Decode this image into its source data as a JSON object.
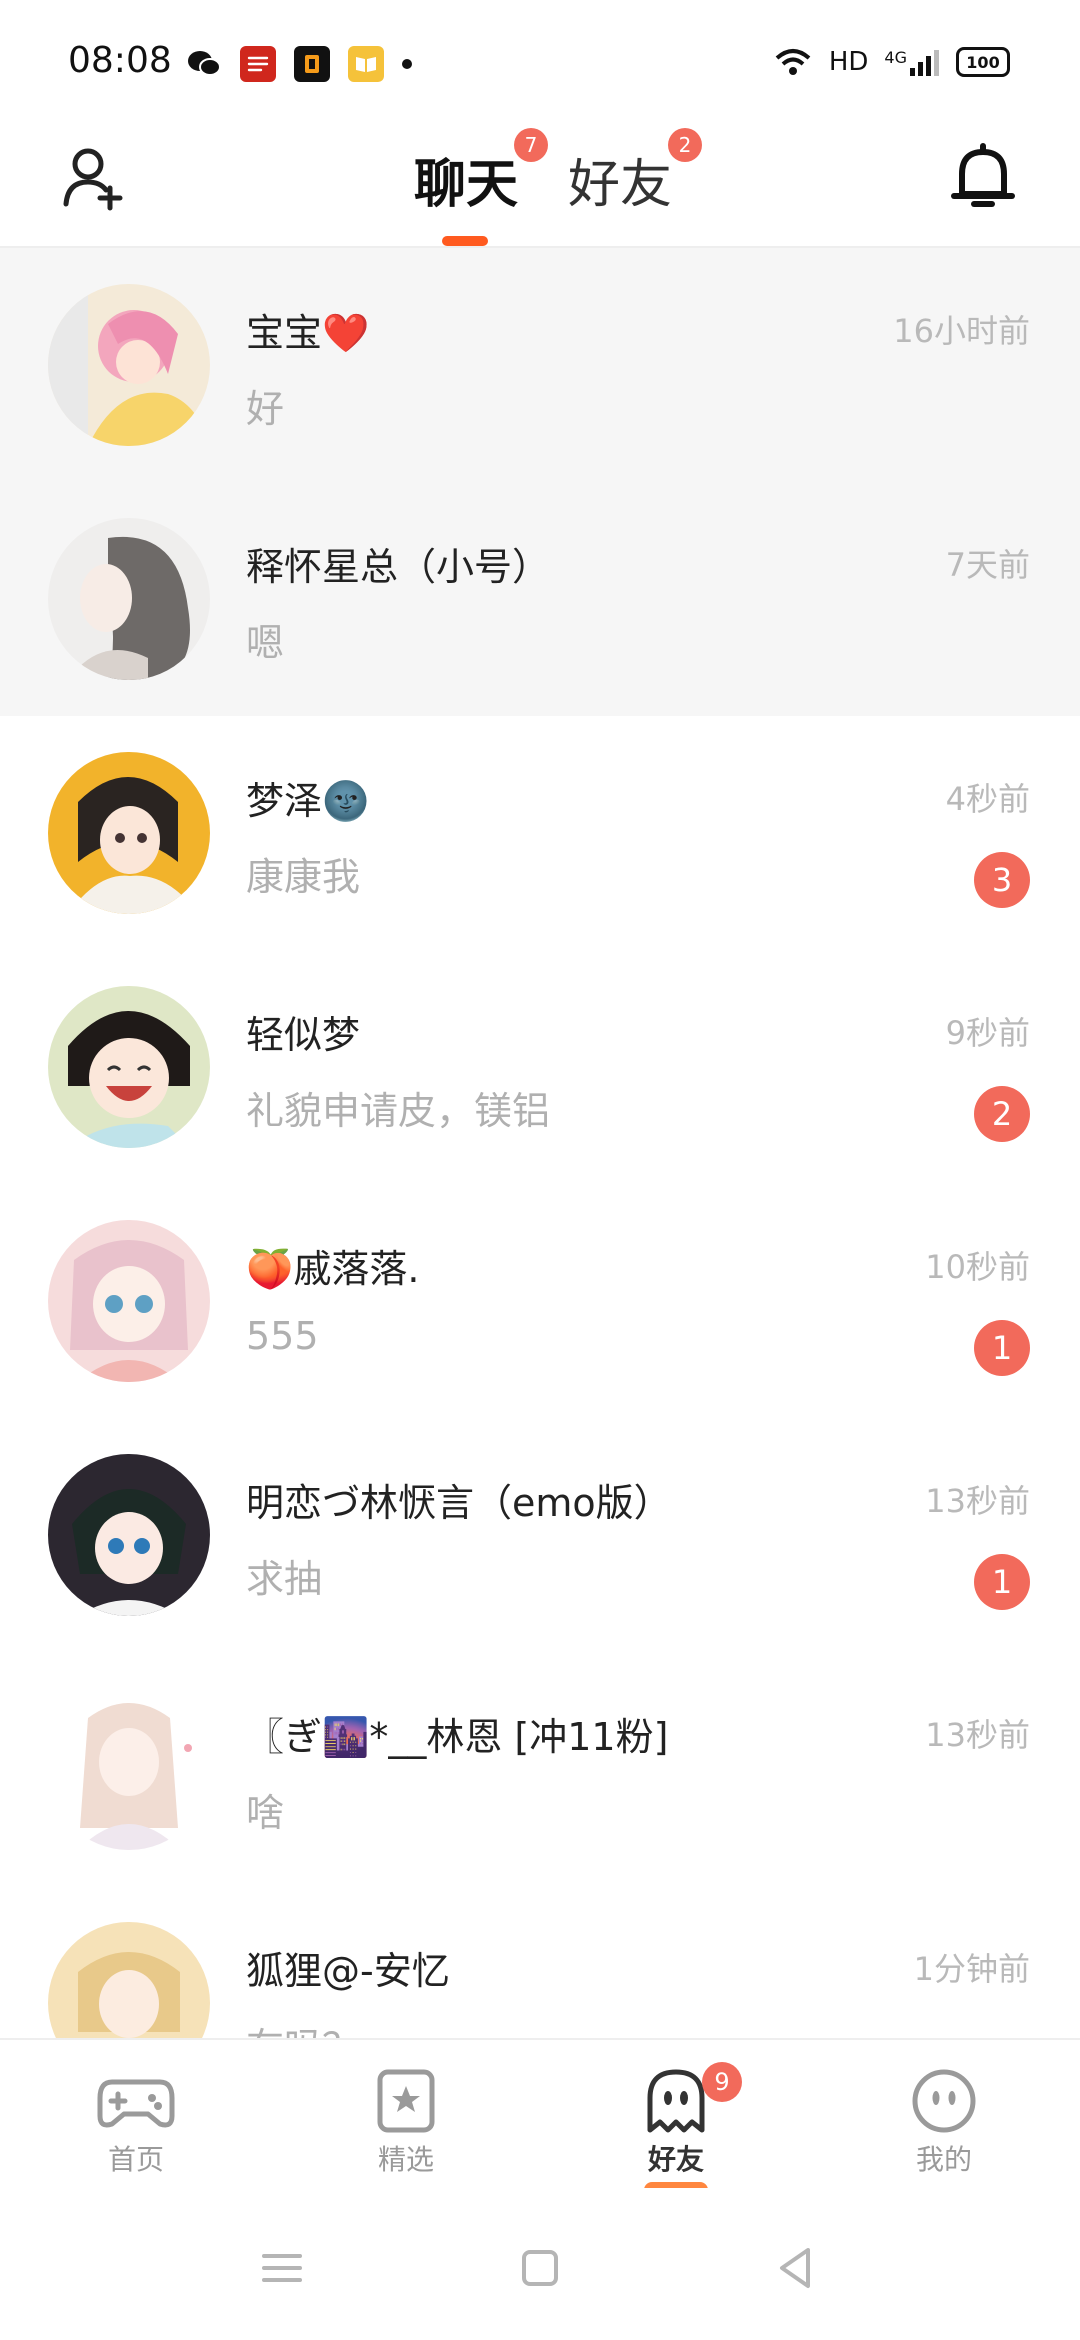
{
  "status_bar": {
    "time": "08:08",
    "network": "HD",
    "signal": "4G",
    "battery": "100"
  },
  "header": {
    "tabs": [
      {
        "label": "聊天",
        "badge": "7"
      },
      {
        "label": "好友",
        "badge": "2"
      }
    ]
  },
  "chats": [
    {
      "name": "宝宝❤️",
      "message": "好",
      "time": "16小时前",
      "pinned": true
    },
    {
      "name": "释怀星总（小号）",
      "message": "嗯",
      "time": "7天前",
      "pinned": true
    },
    {
      "name": "梦泽🌚",
      "message": "康康我",
      "time": "4秒前",
      "unread": "3"
    },
    {
      "name": "轻似梦",
      "message": "礼貌申请皮，镁铝",
      "time": "9秒前",
      "unread": "2"
    },
    {
      "name": "🍑戚落落.",
      "message": "555",
      "time": "10秒前",
      "unread": "1"
    },
    {
      "name": "明恋づ林恹言（emo版）",
      "message": "求抽",
      "time": "13秒前",
      "unread": "1"
    },
    {
      "name": "〖ぎ🌆*__林恩 [冲11粉]",
      "message": "啥",
      "time": "13秒前"
    },
    {
      "name": "狐狸@-安忆",
      "message": "在吗？",
      "time": "1分钟前"
    }
  ],
  "bottom_nav": {
    "items": [
      {
        "label": "首页",
        "icon": "gamepad-icon"
      },
      {
        "label": "精选",
        "icon": "star-bookmark-icon"
      },
      {
        "label": "好友",
        "icon": "ghost-icon",
        "badge": "9"
      },
      {
        "label": "我的",
        "icon": "smiley-icon"
      }
    ]
  },
  "colors": {
    "accent": "#ff5a1f",
    "badge": "#f26a5b",
    "muted_text": "#b0b0b0"
  }
}
